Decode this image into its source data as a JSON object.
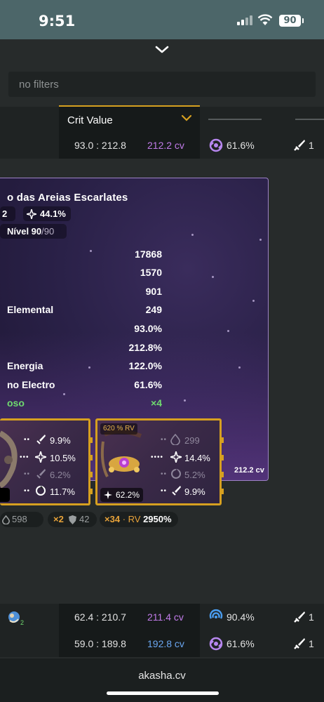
{
  "status_bar": {
    "time": "9:51",
    "battery": "90"
  },
  "filter": {
    "placeholder": "no filters"
  },
  "table_header": {
    "sort_column": "Crit Value"
  },
  "rows": [
    {
      "ratio": "93.0 : 212.8",
      "cv": "212.2 cv",
      "cv_color": "#c07be8",
      "element_value": "61.6%",
      "element_icon": "electro-icon",
      "sword_value": "1"
    },
    {
      "ratio": "62.4 : 210.7",
      "cv": "211.4 cv",
      "cv_color": "#c07be8",
      "element_value": "90.4%",
      "element_icon": "hydro-icon",
      "sword_value": "1"
    },
    {
      "ratio": "59.0 : 189.8",
      "cv": "192.8 cv",
      "cv_color": "#6aa6f0",
      "element_value": "61.6%",
      "element_icon": "electro-icon",
      "sword_value": "1"
    }
  ],
  "card": {
    "title": "o das Areias Escarlates",
    "pill_a": "2",
    "pill_b": "44.1%",
    "level_label": "Nível 90",
    "level_max": "/90",
    "stats": [
      {
        "name": "",
        "value": "17868"
      },
      {
        "name": "",
        "value": "1570"
      },
      {
        "name": "",
        "value": "901"
      },
      {
        "name": "Elemental",
        "value": "249"
      },
      {
        "name": "",
        "value": "93.0%"
      },
      {
        "name": "",
        "value": "212.8%"
      },
      {
        "name": "Energia",
        "value": "122.0%"
      },
      {
        "name": "no Electro",
        "value": "61.6%"
      },
      {
        "name": "oso",
        "value": "×4"
      }
    ],
    "cv": "212.2 cv"
  },
  "artifacts": [
    {
      "substats": [
        {
          "dots": "••",
          "icon": "crit-dmg-icon",
          "value": "9.9%",
          "dim": false
        },
        {
          "dots": "•••",
          "icon": "crit-rate-icon",
          "value": "10.5%",
          "dim": false
        },
        {
          "dots": "••",
          "icon": "crit-dmg-icon",
          "value": "6.2%",
          "dim": true
        },
        {
          "dots": "••",
          "icon": "energy-icon",
          "value": "11.7%",
          "dim": false
        }
      ]
    },
    {
      "rv": "620 % RV",
      "main_stat": "62.2%",
      "substats": [
        {
          "dots": "••",
          "icon": "hp-icon",
          "value": "299",
          "dim": true
        },
        {
          "dots": "••••",
          "icon": "crit-rate-icon",
          "value": "14.4%",
          "dim": false
        },
        {
          "dots": "••",
          "icon": "energy-icon",
          "value": "5.2%",
          "dim": true
        },
        {
          "dots": "••",
          "icon": "crit-dmg-icon",
          "value": "9.9%",
          "dim": false
        }
      ]
    }
  ],
  "tags": {
    "hp": "598",
    "set_count": "×2",
    "def": "42",
    "rolls": "×34",
    "rv_label": "· RV",
    "rv_value": "2950%"
  },
  "footer": {
    "domain": "akasha.cv"
  }
}
